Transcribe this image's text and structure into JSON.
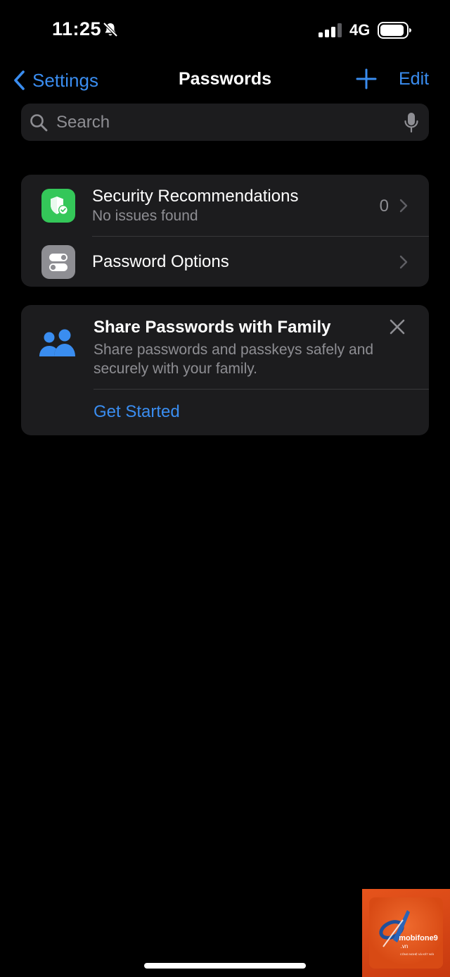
{
  "status_bar": {
    "time": "11:25",
    "network": "4G"
  },
  "nav": {
    "back_label": "Settings",
    "title": "Passwords",
    "edit_label": "Edit"
  },
  "search": {
    "placeholder": "Search"
  },
  "rows": [
    {
      "title": "Security Recommendations",
      "subtitle": "No issues found",
      "count": "0"
    },
    {
      "title": "Password Options"
    }
  ],
  "family_card": {
    "title": "Share Passwords with Family",
    "body": "Share passwords and passkeys safely and securely with your family.",
    "action_label": "Get Started"
  },
  "watermark": {
    "brand": "mobifone9",
    "domain": ".vn",
    "tagline": "CÔNG NGHỆ VÀ KẾT NỐI"
  },
  "icons": {
    "bell": "bell-slash-icon",
    "signal": "cellular-signal-icon",
    "battery": "battery-icon",
    "back": "chevron-left-icon",
    "add": "plus-icon",
    "search": "magnifying-glass-icon",
    "mic": "microphone-icon",
    "security": "shield-check-icon",
    "options": "toggles-icon",
    "chevron": "chevron-right-icon",
    "family": "people-icon",
    "close": "xmark-icon"
  },
  "colors": {
    "accent": "#3a8df0",
    "background": "#000000",
    "card": "#1c1c1e",
    "secondary_text": "#8e8e93",
    "security_green": "#34c759",
    "options_gray": "#8e8e93"
  }
}
